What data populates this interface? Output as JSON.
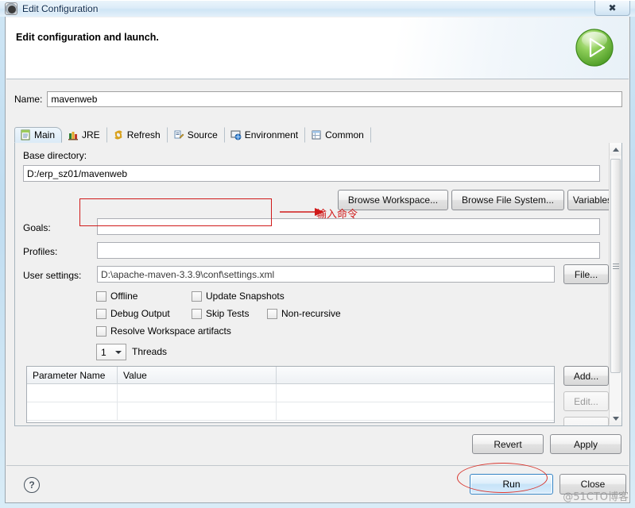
{
  "window": {
    "title": "Edit Configuration",
    "icon": "gear-icon",
    "close_label": "✖"
  },
  "banner": {
    "title": "Edit configuration and launch.",
    "icon": "green-run-play-icon"
  },
  "name_field": {
    "label": "Name:",
    "value": "mavenweb",
    "placeholder": ""
  },
  "tabs": [
    {
      "label": "Main",
      "icon": "document-icon",
      "active": true
    },
    {
      "label": "JRE",
      "icon": "books-icon",
      "active": false
    },
    {
      "label": "Refresh",
      "icon": "refresh-arrows-icon",
      "active": false
    },
    {
      "label": "Source",
      "icon": "source-pencil-icon",
      "active": false
    },
    {
      "label": "Environment",
      "icon": "environment-monitor-icon",
      "active": false
    },
    {
      "label": "Common",
      "icon": "common-table-icon",
      "active": false
    }
  ],
  "main_tab": {
    "base_directory": {
      "label": "Base directory:",
      "value": "D:/erp_sz01/mavenweb",
      "placeholder": ""
    },
    "browse_buttons": [
      "Browse Workspace...",
      "Browse File System...",
      "Variables..."
    ],
    "goals": {
      "label": "Goals:",
      "value": "",
      "placeholder": ""
    },
    "profiles": {
      "label": "Profiles:",
      "value": "",
      "placeholder": ""
    },
    "user_settings": {
      "label": "User settings:",
      "value": "D:\\apache-maven-3.3.9\\conf\\settings.xml",
      "placeholder": "",
      "button": "File..."
    },
    "checkboxes": [
      {
        "label": "Offline",
        "checked": false
      },
      {
        "label": "Update Snapshots",
        "checked": false
      },
      {
        "label": "Debug Output",
        "checked": false
      },
      {
        "label": "Skip Tests",
        "checked": false
      },
      {
        "label": "Non-recursive",
        "checked": false
      },
      {
        "label": "Resolve Workspace artifacts",
        "checked": false
      }
    ],
    "threads": {
      "value": "1",
      "label": "Threads"
    },
    "parameter_table": {
      "columns": [
        "Parameter Name",
        "Value",
        ""
      ],
      "rows": [],
      "buttons": [
        {
          "label": "Add...",
          "enabled": true
        },
        {
          "label": "Edit...",
          "enabled": false
        }
      ]
    }
  },
  "footer": {
    "help_icon": "help-question-icon",
    "revert_label": "Revert",
    "apply_label": "Apply",
    "run_label": "Run",
    "close_label": "Close"
  },
  "annotations": {
    "note_text": "输入命令",
    "note_color": "#d01a1a",
    "highlight_color": "#d01a1a",
    "run_circle_color": "#d8372f",
    "watermark": "@51CTO博客"
  }
}
